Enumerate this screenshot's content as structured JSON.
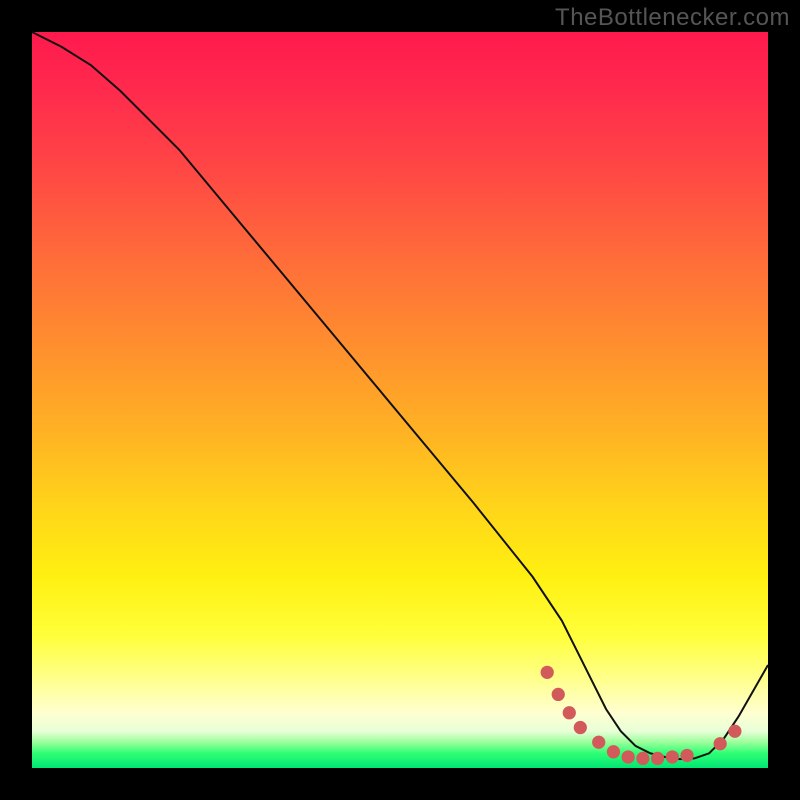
{
  "watermark": "TheBottlenecker.com",
  "chart_data": {
    "type": "line",
    "title": "",
    "xlabel": "",
    "ylabel": "",
    "xlim": [
      0,
      100
    ],
    "ylim": [
      0,
      100
    ],
    "series": [
      {
        "name": "curve",
        "x": [
          0,
          4,
          8,
          12,
          20,
          30,
          40,
          50,
          60,
          68,
          72,
          74,
          76,
          78,
          80,
          82,
          84,
          86,
          88,
          90,
          92,
          94,
          96,
          98,
          100
        ],
        "y": [
          100,
          98,
          95.5,
          92,
          84,
          72,
          60,
          48,
          36,
          26,
          20,
          16,
          12,
          8,
          5,
          3,
          2,
          1.5,
          1.2,
          1.3,
          2,
          4,
          7,
          10.5,
          14
        ]
      }
    ],
    "markers": {
      "name": "dots",
      "color": "#d35a5a",
      "x": [
        70,
        71.5,
        73,
        74.5,
        77,
        79,
        81,
        83,
        85,
        87,
        89,
        93.5,
        95.5
      ],
      "y": [
        13,
        10,
        7.5,
        5.5,
        3.5,
        2.2,
        1.5,
        1.3,
        1.3,
        1.5,
        1.7,
        3.3,
        5
      ]
    },
    "gradient_stops": [
      {
        "pos": 0.0,
        "color": "#ff1a4d"
      },
      {
        "pos": 0.3,
        "color": "#ff6a3a"
      },
      {
        "pos": 0.64,
        "color": "#ffd31a"
      },
      {
        "pos": 0.88,
        "color": "#ffff8d"
      },
      {
        "pos": 0.96,
        "color": "#9bff9b"
      },
      {
        "pos": 1.0,
        "color": "#00e673"
      }
    ]
  }
}
